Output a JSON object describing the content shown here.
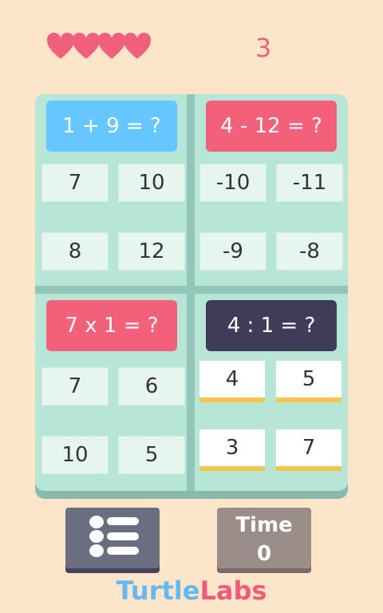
{
  "status": {
    "lives": 4,
    "score": "3"
  },
  "puzzles": [
    {
      "question": "1 + 9 = ?",
      "answers": [
        "7",
        "10",
        "8",
        "12"
      ]
    },
    {
      "question": "4 - 12 = ?",
      "answers": [
        "-10",
        "-11",
        "-9",
        "-8"
      ]
    },
    {
      "question": "7 x 1 = ?",
      "answers": [
        "7",
        "6",
        "10",
        "5"
      ]
    },
    {
      "question": "4 : 1 = ?",
      "answers": [
        "4",
        "5",
        "3",
        "7"
      ]
    }
  ],
  "timer": {
    "label": "Time",
    "value": "0"
  },
  "brand": {
    "part1": "Turtle",
    "part2": "Labs"
  },
  "colors": {
    "background": "#fde5ca",
    "heart": "#f0607a",
    "board": "#b7e5d6",
    "question_blue": "#66c7ff",
    "question_pink": "#f2607a",
    "question_dark": "#3f3c5a",
    "active_answer_underline": "#f5c64b"
  }
}
